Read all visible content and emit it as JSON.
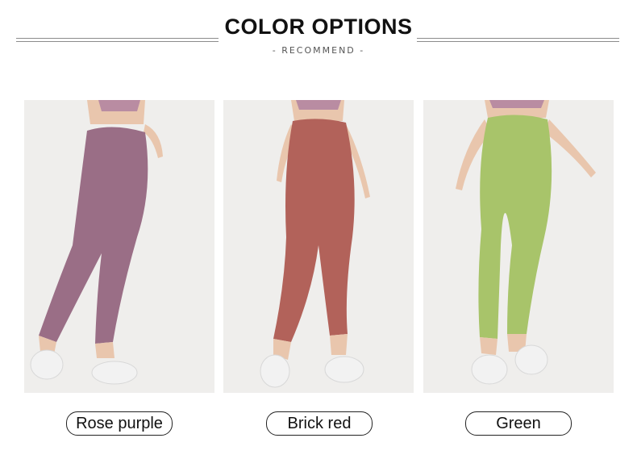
{
  "header": {
    "title": "COLOR OPTIONS",
    "subtitle": "- RECOMMEND -"
  },
  "options": [
    {
      "label": "Rose purple",
      "color": "#9a6e86"
    },
    {
      "label": "Brick red",
      "color": "#b2625a"
    },
    {
      "label": "Green",
      "color": "#a8c46a"
    }
  ],
  "palette": {
    "background": "#ffffff",
    "card_bg": "#efeeec",
    "skin": "#e9c6ad",
    "shoe": "#f2f2f2",
    "top": "#b98ca2"
  }
}
